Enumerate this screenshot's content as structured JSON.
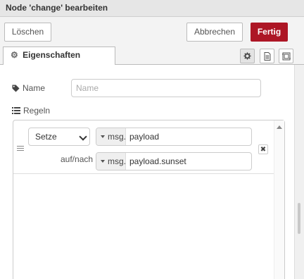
{
  "dialog": {
    "title": "Node 'change' bearbeiten"
  },
  "toolbar": {
    "delete_label": "Löschen",
    "cancel_label": "Abbrechen",
    "done_label": "Fertig"
  },
  "tabs": {
    "properties_label": "Eigenschaften",
    "icons": [
      "gear-icon",
      "document-icon",
      "frame-icon"
    ]
  },
  "form": {
    "name_label": "Name",
    "name_placeholder": "Name",
    "name_value": "",
    "rules_label": "Regeln"
  },
  "rules": [
    {
      "action": "Setze",
      "target_type": "msg.",
      "target_value": "payload",
      "to_label": "auf/nach",
      "source_type": "msg.",
      "source_value": "payload.sunset"
    }
  ],
  "colors": {
    "primary_button": "#ad1625",
    "titlebar": "#e6e6e6"
  }
}
